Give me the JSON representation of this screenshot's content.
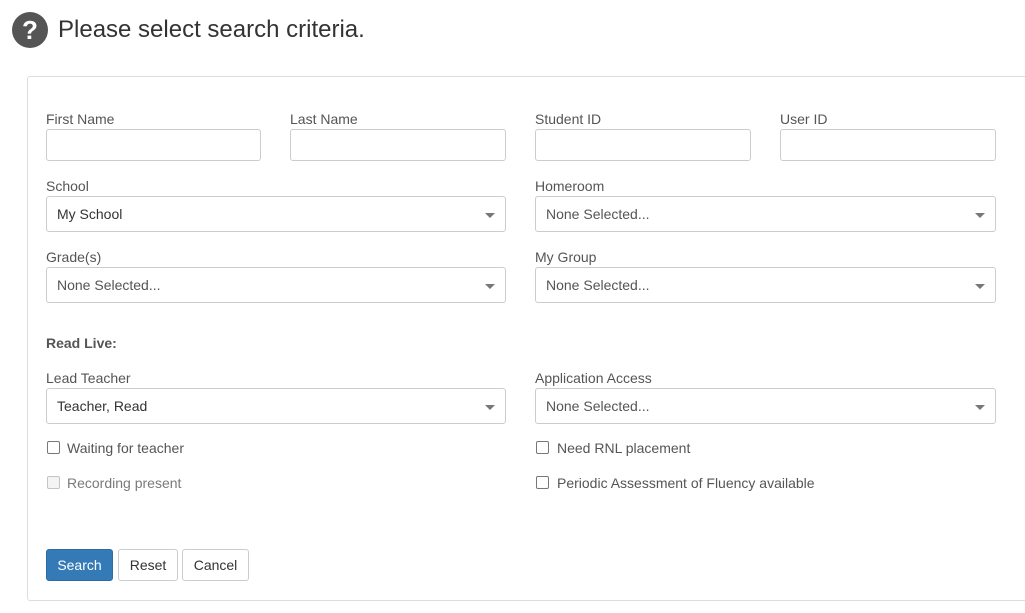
{
  "header": {
    "title": "Please select search criteria.",
    "icon": "question-circle-icon"
  },
  "fields": {
    "first_name": {
      "label": "First Name",
      "value": ""
    },
    "last_name": {
      "label": "Last Name",
      "value": ""
    },
    "student_id": {
      "label": "Student ID",
      "value": ""
    },
    "user_id": {
      "label": "User ID",
      "value": ""
    }
  },
  "selects": {
    "school": {
      "label": "School",
      "value": "My School"
    },
    "homeroom": {
      "label": "Homeroom",
      "value": "None Selected..."
    },
    "grades": {
      "label": "Grade(s)",
      "value": "None Selected..."
    },
    "my_group": {
      "label": "My Group",
      "value": "None Selected..."
    },
    "lead_teacher": {
      "label": "Lead Teacher",
      "value": "Teacher, Read"
    },
    "application_access": {
      "label": "Application Access",
      "value": "None Selected..."
    }
  },
  "section": {
    "read_live": "Read Live:"
  },
  "checkboxes": {
    "waiting_for_teacher": {
      "label": "Waiting for teacher",
      "checked": false,
      "disabled": false
    },
    "recording_present": {
      "label": "Recording present",
      "checked": false,
      "disabled": true
    },
    "need_rnl_placement": {
      "label": "Need RNL placement",
      "checked": false,
      "disabled": false
    },
    "periodic_assessment": {
      "label": "Periodic Assessment of Fluency available",
      "checked": false,
      "disabled": false
    }
  },
  "buttons": {
    "search": "Search",
    "reset": "Reset",
    "cancel": "Cancel"
  },
  "colors": {
    "primary": "#337ab7",
    "text": "#555555",
    "border": "#cccccc",
    "icon": "#555555"
  }
}
